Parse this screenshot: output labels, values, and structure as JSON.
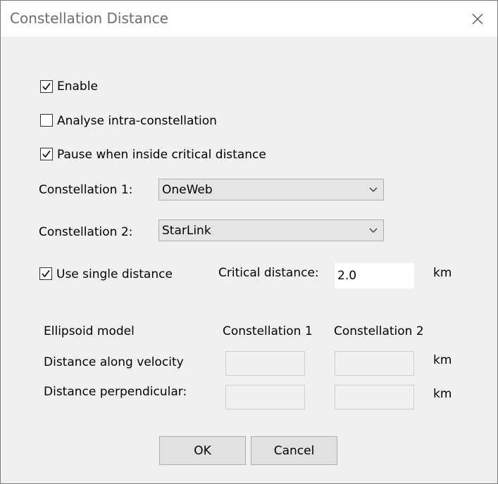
{
  "window": {
    "title": "Constellation Distance"
  },
  "options": {
    "enable": {
      "label": "Enable",
      "checked": true
    },
    "analyse_intra": {
      "label": "Analyse intra-constellation",
      "checked": false
    },
    "pause_inside": {
      "label": "Pause when inside critical distance",
      "checked": true
    }
  },
  "constellation1": {
    "label": "Constellation 1:",
    "selected": "OneWeb"
  },
  "constellation2": {
    "label": "Constellation 2:",
    "selected": "StarLink"
  },
  "single_distance": {
    "label": "Use single distance",
    "checked": true,
    "critical_label": "Critical distance:",
    "critical_value": "2.0",
    "unit": "km"
  },
  "ellipsoid": {
    "model_label": "Ellipsoid model",
    "col1_header": "Constellation 1",
    "col2_header": "Constellation 2",
    "along_velocity_label": "Distance along velocity",
    "perpendicular_label": "Distance perpendicular:",
    "along_velocity_c1": "",
    "along_velocity_c2": "",
    "perpendicular_c1": "",
    "perpendicular_c2": "",
    "unit_along": "km",
    "unit_perp": "km"
  },
  "buttons": {
    "ok": "OK",
    "cancel": "Cancel"
  }
}
